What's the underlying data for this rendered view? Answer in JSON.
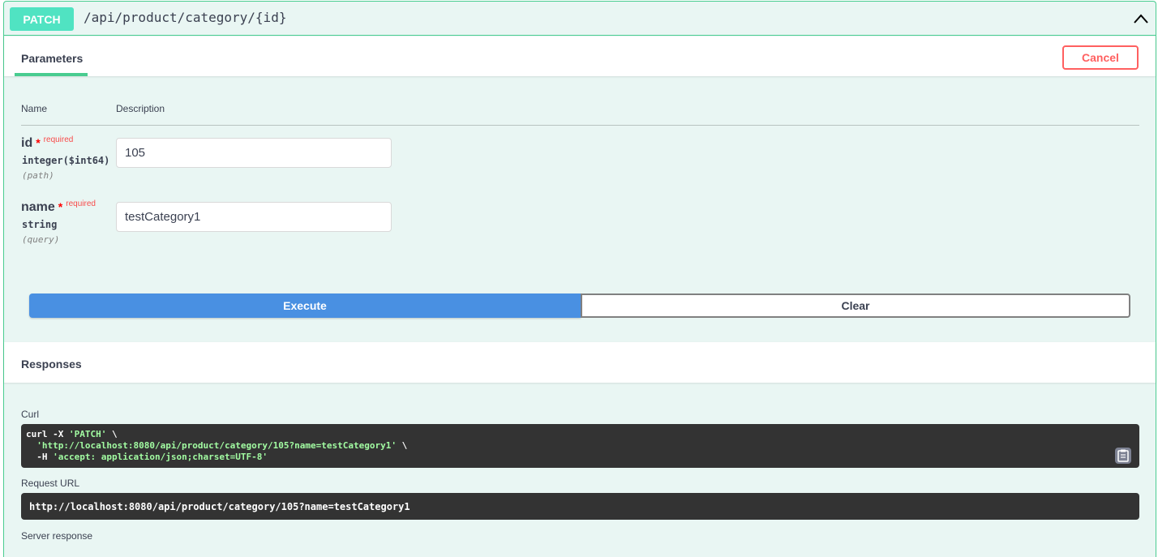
{
  "operation": {
    "method": "PATCH",
    "path": "/api/product/category/{id}"
  },
  "tabs": {
    "parameters": "Parameters",
    "cancel": "Cancel"
  },
  "table": {
    "col_name": "Name",
    "col_description": "Description"
  },
  "params": [
    {
      "name": "id",
      "star": "*",
      "required": "required",
      "type": "integer($int64)",
      "in": "(path)",
      "value": "105"
    },
    {
      "name": "name",
      "star": "*",
      "required": "required",
      "type": "string",
      "in": "(query)",
      "value": "testCategory1"
    }
  ],
  "actions": {
    "execute": "Execute",
    "clear": "Clear"
  },
  "responses": {
    "title": "Responses",
    "curl_label": "Curl",
    "curl_lines": [
      {
        "pre": "curl -X ",
        "str": "'PATCH'",
        "post": " \\"
      },
      {
        "pre": "  ",
        "str": "'http://localhost:8080/api/product/category/105?name=testCategory1'",
        "post": " \\"
      },
      {
        "pre": "  -H ",
        "str": "'accept: application/json;charset=UTF-8'",
        "post": ""
      }
    ],
    "request_url_label": "Request URL",
    "request_url": "http://localhost:8080/api/product/category/105?name=testCategory1",
    "server_response_label": "Server response"
  },
  "icons": {
    "collapse": "chevron-up-icon",
    "copy": "clipboard-icon"
  },
  "colors": {
    "accent": "#49cc90",
    "method_badge": "#50e3c2",
    "execute": "#4990e2",
    "cancel": "#ff6060",
    "code_bg": "#333333"
  }
}
